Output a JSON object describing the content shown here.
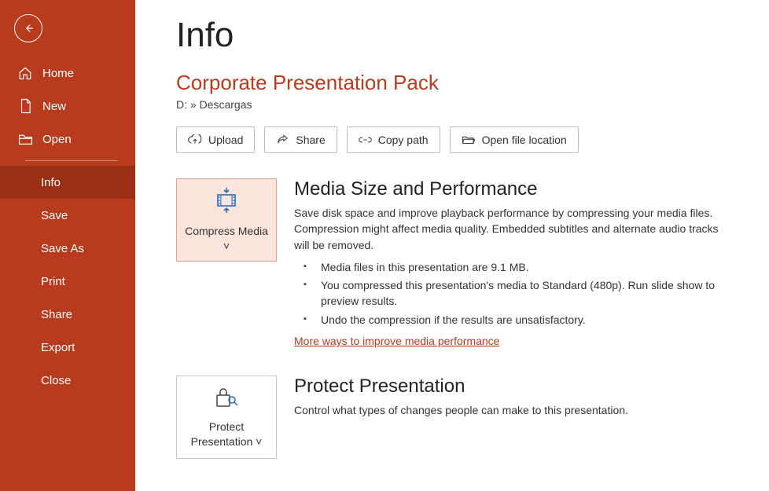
{
  "sidebar": {
    "items": {
      "home": "Home",
      "new": "New",
      "open": "Open",
      "info": "Info",
      "save": "Save",
      "saveAs": "Save As",
      "print": "Print",
      "share": "Share",
      "export": "Export",
      "close": "Close"
    }
  },
  "page": {
    "title": "Info",
    "docTitle": "Corporate Presentation Pack",
    "docPath": "D: » Descargas"
  },
  "toolbar": {
    "upload": "Upload",
    "share": "Share",
    "copyPath": "Copy path",
    "openLocation": "Open file location"
  },
  "media": {
    "tileLabel": "Compress Media",
    "heading": "Media Size and Performance",
    "desc": "Save disk space and improve playback performance by compressing your media files. Compression might affect media quality. Embedded subtitles and alternate audio tracks will be removed.",
    "bullet1": "Media files in this presentation are 9.1 MB.",
    "bullet2": "You compressed this presentation's media to Standard (480p). Run slide show to preview results.",
    "bullet3": "Undo the compression if the results are unsatisfactory.",
    "link": "More ways to improve media performance"
  },
  "protect": {
    "tileLabel": "Protect Presentation",
    "heading": "Protect Presentation",
    "desc": "Control what types of changes people can make to this presentation."
  }
}
